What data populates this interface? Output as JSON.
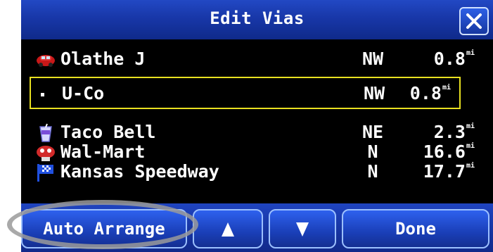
{
  "header": {
    "title": "Edit Vias",
    "close_icon": "close-icon"
  },
  "vias": [
    {
      "icon": "car-icon",
      "name": "Olathe J",
      "direction": "NW",
      "distance": "0.8",
      "unit": "mi",
      "selected": false
    },
    {
      "icon": "dot-icon",
      "name": "U-Co",
      "direction": "NW",
      "distance": "0.8",
      "unit": "mi",
      "selected": true
    },
    {
      "icon": "drink-cup-icon",
      "name": "Taco Bell",
      "direction": "NE",
      "distance": "2.3",
      "unit": "mi",
      "selected": false
    },
    {
      "icon": "shopping-icon",
      "name": "Wal-Mart",
      "direction": "N",
      "distance": "16.6",
      "unit": "mi",
      "selected": false
    },
    {
      "icon": "checkered-flag-icon",
      "name": "Kansas Speedway",
      "direction": "N",
      "distance": "17.7",
      "unit": "mi",
      "selected": false
    }
  ],
  "buttons": {
    "auto_arrange": "Auto Arrange",
    "move_up_icon": "arrow-up-icon",
    "move_down_icon": "arrow-down-icon",
    "done": "Done"
  },
  "colors": {
    "title_blue": "#1837a8",
    "button_blue": "#2e61ee",
    "selection": "#e8e020",
    "highlight_ring": "#9a9a9a"
  }
}
